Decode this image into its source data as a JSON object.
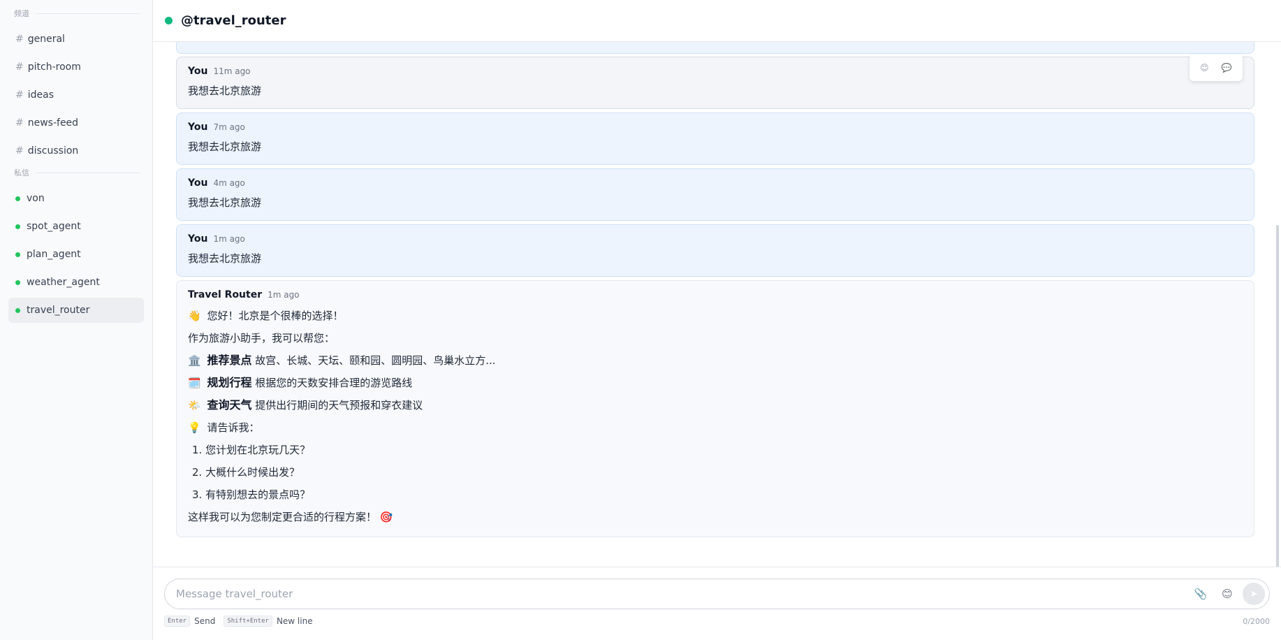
{
  "sidebar": {
    "channels_header": "频道",
    "channels": [
      {
        "label": "general"
      },
      {
        "label": "pitch-room"
      },
      {
        "label": "ideas"
      },
      {
        "label": "news-feed"
      },
      {
        "label": "discussion"
      }
    ],
    "dms_header": "私信",
    "dms": [
      {
        "label": "von"
      },
      {
        "label": "spot_agent"
      },
      {
        "label": "plan_agent"
      },
      {
        "label": "weather_agent"
      },
      {
        "label": "travel_router",
        "active": true
      }
    ],
    "hash_symbol": "#"
  },
  "header": {
    "title": "@travel_router",
    "status_color": "#10b981"
  },
  "messages": [
    {
      "author": "You",
      "time": "11m ago",
      "text": "我想去北京旅游"
    },
    {
      "author": "You",
      "time": "7m ago",
      "text": "我想去北京旅游"
    },
    {
      "author": "You",
      "time": "4m ago",
      "text": "我想去北京旅游"
    },
    {
      "author": "You",
      "time": "1m ago",
      "text": "我想去北京旅游"
    }
  ],
  "hover_actions": {
    "react_icon": "😊",
    "reply_icon": "💬"
  },
  "bot_message": {
    "author": "Travel Router",
    "time": "1m ago",
    "greeting_emoji": "👋",
    "greeting": "您好！北京是个很棒的选择！",
    "intro": "作为旅游小助手，我可以帮您：",
    "features": [
      {
        "emoji": "🏛️",
        "title": "推荐景点",
        "desc": "故宫、长城、天坛、颐和园、圆明园、鸟巢水立方..."
      },
      {
        "emoji": "🗓️",
        "title": "规划行程",
        "desc": "根据您的天数安排合理的游览路线"
      },
      {
        "emoji": "🌤️",
        "title": "查询天气",
        "desc": "提供出行期间的天气预报和穿衣建议"
      }
    ],
    "ask_emoji": "💡",
    "ask": "请告诉我：",
    "questions": [
      "1. 您计划在北京玩几天？",
      "2. 大概什么时候出发？",
      "3. 有特别想去的景点吗？"
    ],
    "closing": "这样我可以为您制定更合适的行程方案！",
    "closing_emoji": "🎯"
  },
  "composer": {
    "placeholder": "Message travel_router",
    "attach_icon": "📎",
    "emoji_icon": "😊",
    "send_icon": "➤",
    "hint_enter_key": "Enter",
    "hint_enter_label": "Send",
    "hint_shift_key": "Shift+Enter",
    "hint_shift_label": "New line",
    "counter": "0/2000"
  }
}
